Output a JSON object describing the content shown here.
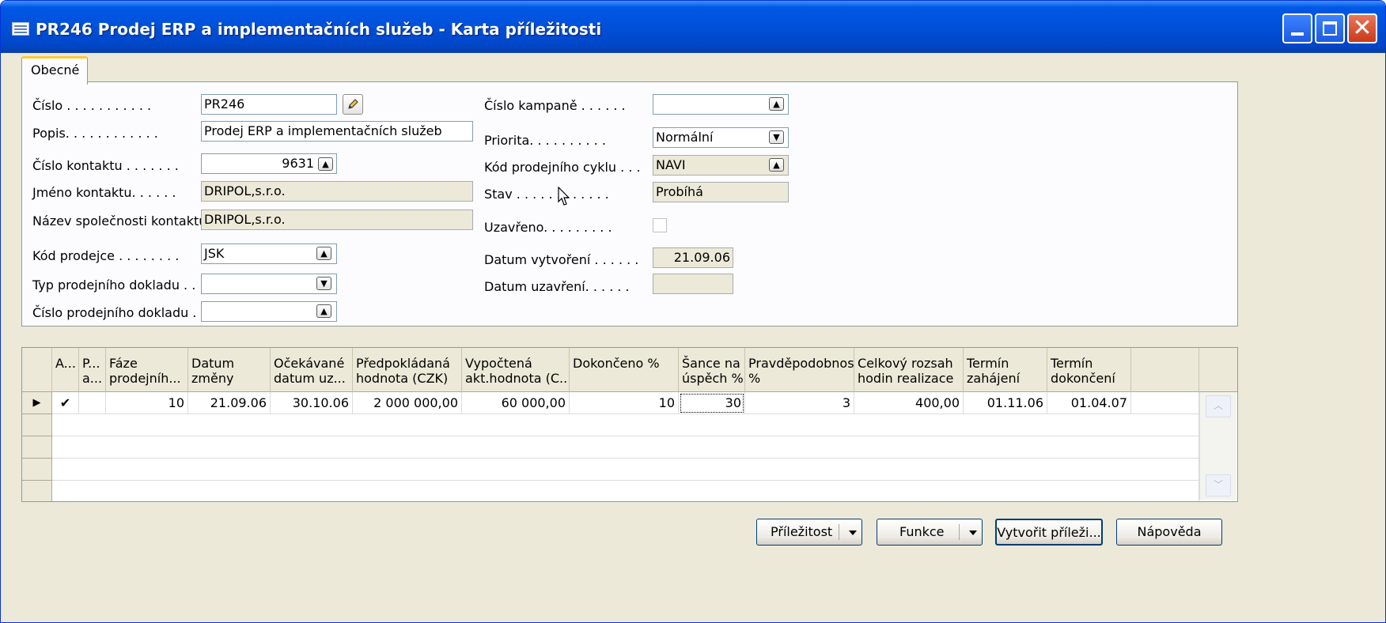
{
  "window": {
    "title": "PR246 Prodej ERP a implementačních služeb - Karta příležitosti"
  },
  "tabs": [
    {
      "label": "Obecné"
    }
  ],
  "form_left": [
    {
      "label": "Číslo . . . . . . . . . . .",
      "value": "PR246"
    },
    {
      "label": "Popis. . . . . . . . . . . .",
      "value": "Prodej ERP a implementačních služeb"
    },
    {
      "label": "Číslo kontaktu . . . . . . .",
      "value": "9631"
    },
    {
      "label": "Jméno kontaktu. . . . . .",
      "value": "DRIPOL,s.r.o."
    },
    {
      "label": "Název společnosti kontaktu",
      "value": "DRIPOL,s.r.o."
    },
    {
      "label": "Kód prodejce . . . . . . . .",
      "value": "JSK"
    },
    {
      "label": "Typ prodejního dokladu . .",
      "value": ""
    },
    {
      "label": "Číslo prodejního dokladu .",
      "value": ""
    }
  ],
  "form_right": [
    {
      "label": "Číslo kampaně . . . . . .",
      "value": ""
    },
    {
      "label": "Priorita. . . . . . . . . .",
      "value": "Normální"
    },
    {
      "label": "Kód prodejního cyklu . . .",
      "value": "NAVI"
    },
    {
      "label": "Stav . . . . . . . . . . . .",
      "value": "Probíhá"
    },
    {
      "label": "Uzavřeno. . . . . . . . .",
      "checked": false
    },
    {
      "label": "Datum vytvoření . . . . . .",
      "value": "21.09.06"
    },
    {
      "label": "Datum uzavření. . . . . .",
      "value": ""
    }
  ],
  "grid": {
    "columns": [
      {
        "line1": "",
        "line2": "A..."
      },
      {
        "line1": "P...",
        "line2": "a..."
      },
      {
        "line1": "Fáze",
        "line2": "prodejníh..."
      },
      {
        "line1": "Datum",
        "line2": "změny"
      },
      {
        "line1": "Očekávané",
        "line2": "datum uz..."
      },
      {
        "line1": "Předpokládaná",
        "line2": "hodnota (CZK)"
      },
      {
        "line1": "Vypočtená",
        "line2": "akt.hodnota (C..."
      },
      {
        "line1": "",
        "line2": "Dokončeno %"
      },
      {
        "line1": "Šance na",
        "line2": "úspěch %"
      },
      {
        "line1": "Pravděpodobnost",
        "line2": "%"
      },
      {
        "line1": "Celkový rozsah",
        "line2": "hodin realizace"
      },
      {
        "line1": "Termín",
        "line2": "zahájení"
      },
      {
        "line1": "Termín",
        "line2": "dokončení"
      }
    ],
    "rows": [
      [
        "✔",
        "",
        "10",
        "21.09.06",
        "30.10.06",
        "2 000 000,00",
        "60 000,00",
        "10",
        "30",
        "3",
        "400,00",
        "01.11.06",
        "01.04.07"
      ]
    ],
    "current_row_marker": "▶"
  },
  "buttons": {
    "prilezitost": "Příležitost",
    "funkce": "Funkce",
    "vytvorit": "Vytvořit příleži...",
    "napoveda": "Nápověda"
  },
  "icons": {
    "lookup": "▲",
    "dropdown": "▼",
    "edit": "pencil-icon"
  }
}
